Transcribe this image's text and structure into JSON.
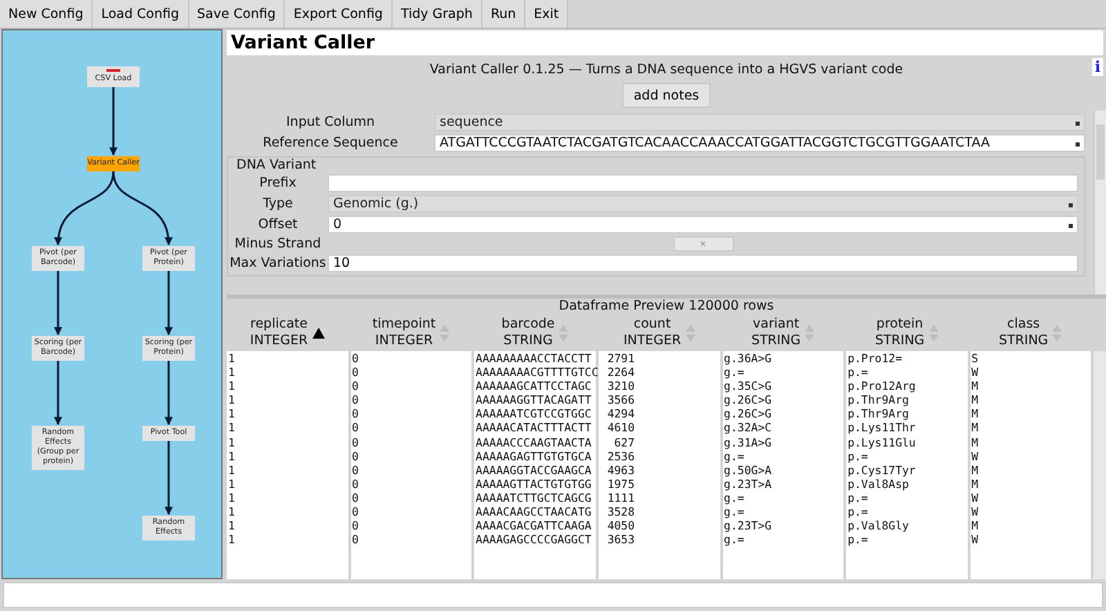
{
  "toolbar": [
    "New Config",
    "Load Config",
    "Save Config",
    "Export Config",
    "Tidy Graph",
    "Run",
    "Exit"
  ],
  "graph": {
    "label": "CSV Load",
    "flagged": true,
    "selected": false,
    "children": [
      {
        "label": "Variant Caller",
        "flagged": false,
        "selected": true,
        "children": [
          {
            "label": "Pivot (per Barcode)",
            "flagged": false,
            "selected": false,
            "children": [
              {
                "label": "Scoring (per Barcode)",
                "flagged": false,
                "selected": false,
                "children": [
                  {
                    "label": "Random Effects (Group per protein)",
                    "flagged": false,
                    "selected": false
                  }
                ]
              }
            ]
          },
          {
            "label": "Pivot (per Protein)",
            "flagged": false,
            "selected": false,
            "children": [
              {
                "label": "Scoring (per Protein)",
                "flagged": false,
                "selected": false,
                "children": [
                  {
                    "label": "Pivot Tool",
                    "flagged": false,
                    "selected": false,
                    "children": [
                      {
                        "label": "Random Effects",
                        "flagged": false,
                        "selected": false
                      }
                    ]
                  }
                ]
              }
            ]
          }
        ]
      }
    ]
  },
  "title": "Variant Caller",
  "description": "Variant Caller 0.1.25 — Turns a DNA sequence into a HGVS variant code",
  "info_icon": "i",
  "notes_button": "add notes",
  "fields": [
    {
      "kind": "select",
      "label": "Input Column",
      "value": "sequence"
    },
    {
      "kind": "combo",
      "label": "Reference Sequence",
      "value": "ATGATTCCCGTAATCTACGATGTCACAACCAAACCATGGATTACGGTCTGCGTTGGAATCTAA"
    }
  ],
  "section": {
    "title": "DNA Variant",
    "fields": [
      {
        "kind": "text",
        "label": "Prefix"
      },
      {
        "kind": "select",
        "label": "Type",
        "value": "Genomic (g.)"
      },
      {
        "kind": "combo",
        "label": "Offset",
        "value": "0"
      },
      {
        "kind": "toggle",
        "label": "Minus Strand",
        "value": "×"
      },
      {
        "kind": "text",
        "label": "Max Variations",
        "value": "10"
      }
    ]
  },
  "preview": {
    "title": "Dataframe Preview 120000 rows",
    "columns": [
      {
        "name": "replicate",
        "type": "INTEGER",
        "sorted": true,
        "right_aligned": false
      },
      {
        "name": "timepoint",
        "type": "INTEGER",
        "sorted": false,
        "right_aligned": false
      },
      {
        "name": "barcode",
        "type": "STRING",
        "sorted": false,
        "right_aligned": false
      },
      {
        "name": "count",
        "type": "INTEGER",
        "sorted": false,
        "right_aligned": true
      },
      {
        "name": "variant",
        "type": "STRING",
        "sorted": false,
        "right_aligned": false
      },
      {
        "name": "protein",
        "type": "STRING",
        "sorted": false,
        "right_aligned": false
      },
      {
        "name": "class",
        "type": "STRING",
        "sorted": false,
        "right_aligned": false
      }
    ],
    "rows": [
      [
        "1",
        "0",
        "AAAAAAAAACCTACCTT",
        "2791",
        "g.36A>G",
        "p.Pro12=",
        "S"
      ],
      [
        "1",
        "0",
        "AAAAAAAACGTTTTGTCC",
        "2264",
        "g.=",
        "p.=",
        "W"
      ],
      [
        "1",
        "0",
        "AAAAAAGCATTCCTAGC",
        "3210",
        "g.35C>G",
        "p.Pro12Arg",
        "M"
      ],
      [
        "1",
        "0",
        "AAAAAAGGTTACAGATT",
        "3566",
        "g.26C>G",
        "p.Thr9Arg",
        "M"
      ],
      [
        "1",
        "0",
        "AAAAAATCGTCCGTGGC",
        "4294",
        "g.26C>G",
        "p.Thr9Arg",
        "M"
      ],
      [
        "1",
        "0",
        "AAAAACATACTTTACTT",
        "4610",
        "g.32A>C",
        "p.Lys11Thr",
        "M"
      ],
      [
        "1",
        "0",
        "AAAAACCCAAGTAACTA",
        "627",
        "g.31A>G",
        "p.Lys11Glu",
        "M"
      ],
      [
        "1",
        "0",
        "AAAAAGAGTTGTGTGCA",
        "2536",
        "g.=",
        "p.=",
        "W"
      ],
      [
        "1",
        "0",
        "AAAAAGGTACCGAAGCA",
        "4963",
        "g.50G>A",
        "p.Cys17Tyr",
        "M"
      ],
      [
        "1",
        "0",
        "AAAAAGTTACTGTGTGG",
        "1975",
        "g.23T>A",
        "p.Val8Asp",
        "M"
      ],
      [
        "1",
        "0",
        "AAAAATCTTGCTCAGCG",
        "1111",
        "g.=",
        "p.=",
        "W"
      ],
      [
        "1",
        "0",
        "AAAACAAGCCTAACATG",
        "3528",
        "g.=",
        "p.=",
        "W"
      ],
      [
        "1",
        "0",
        "AAAACGACGATTCAAGA",
        "4050",
        "g.23T>G",
        "p.Val8Gly",
        "M"
      ],
      [
        "1",
        "0",
        "AAAAGAGCCCCGAGGCT",
        "3653",
        "g.=",
        "p.=",
        "W"
      ]
    ]
  }
}
